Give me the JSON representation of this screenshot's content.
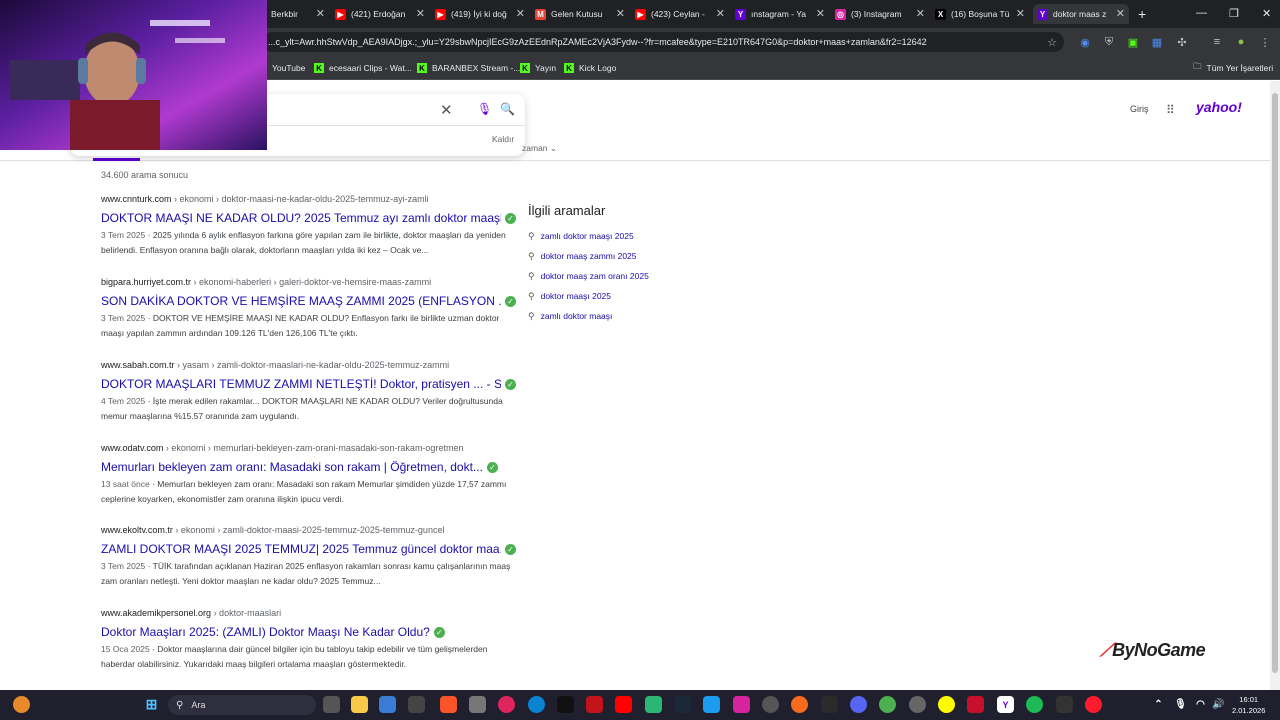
{
  "browser": {
    "tabs": [
      {
        "title": "Berkbir",
        "color": "#5f6368",
        "active": false
      },
      {
        "title": "(421) Erdoğan",
        "color": "#ff0000",
        "active": false
      },
      {
        "title": "(419) İyi ki doğ",
        "color": "#ff0000",
        "active": false
      },
      {
        "title": "Gelen Kutusu",
        "color": "#ea4335",
        "active": false
      },
      {
        "title": "(423) Ceylan -",
        "color": "#ff0000",
        "active": false
      },
      {
        "title": "ınstagram - Ya",
        "color": "#6001d2",
        "active": false
      },
      {
        "title": "(3) Instagram",
        "color": "#d6249f",
        "active": false
      },
      {
        "title": "(16) Boşuna Tü",
        "color": "#000000",
        "active": false
      },
      {
        "title": "doktor maas z",
        "color": "#6001d2",
        "active": true
      }
    ],
    "url": "...c_ylt=Awr.hhStwVdp_AEA9IADjgx.;_ylu=Y29sbwNpcjIEcG9zAzEEdnRpZAMEc2VjA3Fydw--?fr=mcafee&type=E210TR647G0&p=doktor+maas+zamlan&fr2=12642",
    "bookmarks": [
      {
        "label": "YouTube",
        "icon": "youtube-icon"
      },
      {
        "label": "ecesaari Clips - Wat...",
        "icon": "kick-icon"
      },
      {
        "label": "BARANBEX Stream -...",
        "icon": "kick-icon"
      },
      {
        "label": "Yayın",
        "icon": "kick-icon"
      },
      {
        "label": "Kick Logo",
        "icon": "kick-icon"
      }
    ],
    "all_bookmarks": "Tüm Yer İşaretleri"
  },
  "search": {
    "query": "",
    "remove_label": "Kaldır",
    "time_tab": "zaman"
  },
  "header": {
    "login": "Giriş",
    "logo": "yahoo!"
  },
  "results_count": "34.600 arama sonucu",
  "results": [
    {
      "domain": "www.cnnturk.com",
      "path": " › ekonomi › doktor-maasi-ne-kadar-oldu-2025-temmuz-ayi-zamli",
      "title": "DOKTOR MAAŞI NE KADAR OLDU? 2025 Temmuz ayı zamlı doktor maaşl...",
      "date": "3 Tem 2025",
      "snippet": " · 2025 yılında 6 aylık enflasyon farkına göre yapılan zam ile birlikte, doktor maaşları da yeniden belirlendi. Enflasyon oranına bağlı olarak, doktorların maaşları yılda iki kez – Ocak ve..."
    },
    {
      "domain": "bigpara.hurriyet.com.tr",
      "path": " › ekonomi-haberleri › galeri-doktor-ve-hemsire-maas-zammi",
      "title": "SON DAKİKA DOKTOR VE HEMŞİRE MAAŞ ZAMMI 2025 (ENFLASYON ... -...",
      "date": "3 Tem 2025",
      "snippet": " · DOKTOR VE HEMŞİRE MAAŞI NE KADAR OLDU? Enflasyon farkı ile birlikte uzman doktor maaşı yapılan zammın ardından 109.126 TL'den 126,106 TL'te çıktı."
    },
    {
      "domain": "www.sabah.com.tr",
      "path": " › yasam › zamli-doktor-maaslari-ne-kadar-oldu-2025-temmuz-zammi",
      "title": "DOKTOR MAAŞLARI TEMMUZ ZAMMI NETLEŞTİ! Doktor, pratisyen ... - Sa...",
      "date": "4 Tem 2025",
      "snippet": " · İşte merak edilen rakamlar... DOKTOR MAAŞLARI NE KADAR OLDU? Veriler doğrultusunda memur maaşlarına %15.57 oranında zam uygulandı."
    },
    {
      "domain": "www.odatv.com",
      "path": " › ekonomi › memurlari-bekleyen-zam-orani-masadaki-son-rakam-ogretmen",
      "title": "Memurları bekleyen zam oranı: Masadaki son rakam | Öğretmen, dokt...",
      "date": "13 saat önce",
      "snippet": " · Memurları bekleyen zam oranı: Masadaki son rakam Memurlar şimdiden yüzde 17,57 zammı ceplerine koyarken, ekonomistler zam oranına ilişkin ipucu verdi."
    },
    {
      "domain": "www.ekoltv.com.tr",
      "path": " › ekonomi › zamli-doktor-maasi-2025-temmuz-2025-temmuz-guncel",
      "title": "ZAMLI DOKTOR MAAŞI 2025 TEMMUZ| 2025 Temmuz güncel doktor maa...",
      "date": "3 Tem 2025",
      "snippet": " · TÜİK tarafından açıklanan Haziran 2025 enflasyon rakamları sonrası kamu çalışanlarının maaş zam oranları netleşti. Yeni doktor maaşları ne kadar oldu? 2025 Temmuz..."
    },
    {
      "domain": "www.akademikpersonel.org",
      "path": " › doktor-maaslari",
      "title": "Doktor Maaşları 2025: (ZAMLI) Doktor Maaşı Ne Kadar Oldu?",
      "date": "15 Oca 2025",
      "snippet": " · Doktor maaşlarına dair güncel bilgiler için bu tabloyu takip edebilir ve tüm gelişmelerden haberdar olabilirsiniz. Yukarıdaki maaş bilgileri ortalama maaşları göstermektedir."
    }
  ],
  "related": {
    "heading": "İlgili aramalar",
    "items": [
      "zamlı doktor maaşı 2025",
      "doktor maaş zammı 2025",
      "doktor maaş zam oranı 2025",
      "doktor maaşı 2025",
      "zamlı doktor maaşı"
    ]
  },
  "watermark": "ByNoGame",
  "taskbar": {
    "search_label": "Ara",
    "time": "16:01",
    "date": "2.01.2026"
  }
}
